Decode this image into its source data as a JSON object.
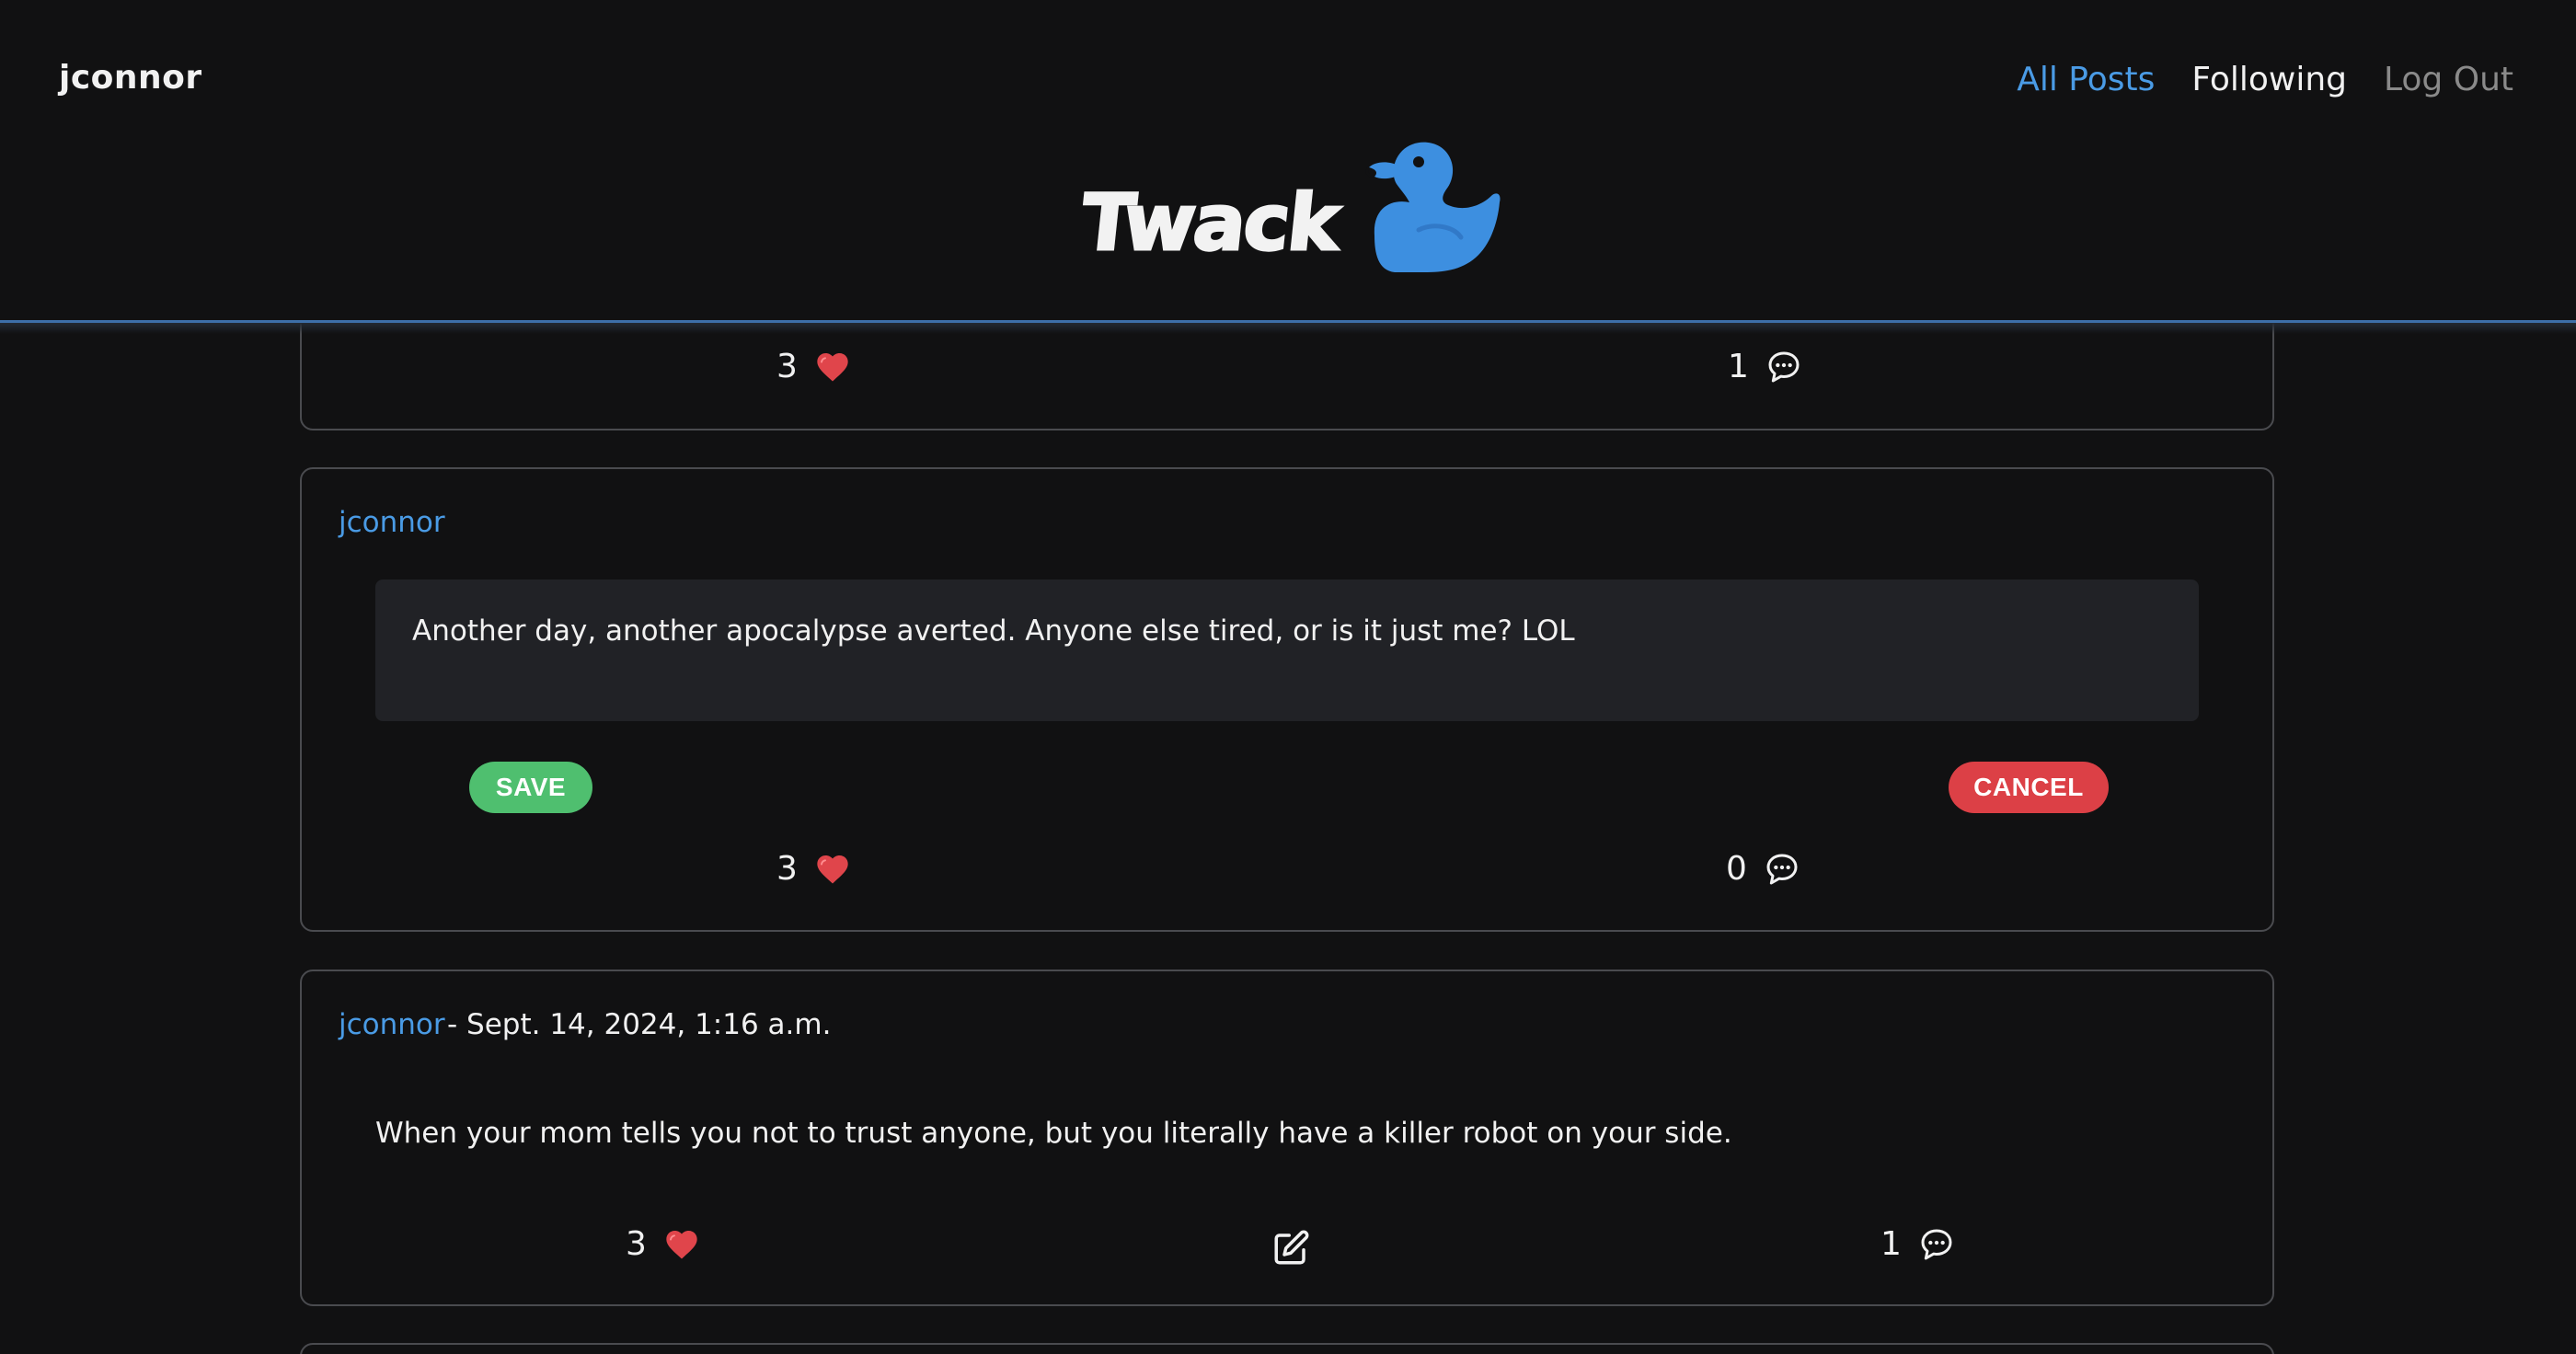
{
  "header": {
    "username": "jconnor",
    "nav": {
      "all_posts": "All Posts",
      "following": "Following",
      "log_out": "Log Out"
    },
    "logo_text": "Twack",
    "logo_icon": "duck-icon",
    "accent_color": "#4a9be5"
  },
  "posts": [
    {
      "likes": "3",
      "comments": "1"
    },
    {
      "author": "jconnor",
      "edit_text": "Another day, another apocalypse averted. Anyone else tired, or is it just me? LOL",
      "save_label": "SAVE",
      "cancel_label": "CANCEL",
      "likes": "3",
      "comments": "0"
    },
    {
      "author": "jconnor",
      "timestamp": "- Sept. 14, 2024, 1:16 a.m.",
      "body": "When your mom tells you not to trust anyone, but you literally have a killer robot on your side.",
      "likes": "3",
      "comments": "1"
    }
  ],
  "icons": {
    "like": "heart-icon",
    "comment": "comment-icon",
    "edit": "edit-icon"
  },
  "colors": {
    "save": "#4fbf6f",
    "cancel": "#dc4046",
    "heart": "#e0454b",
    "link": "#4a9be5"
  }
}
